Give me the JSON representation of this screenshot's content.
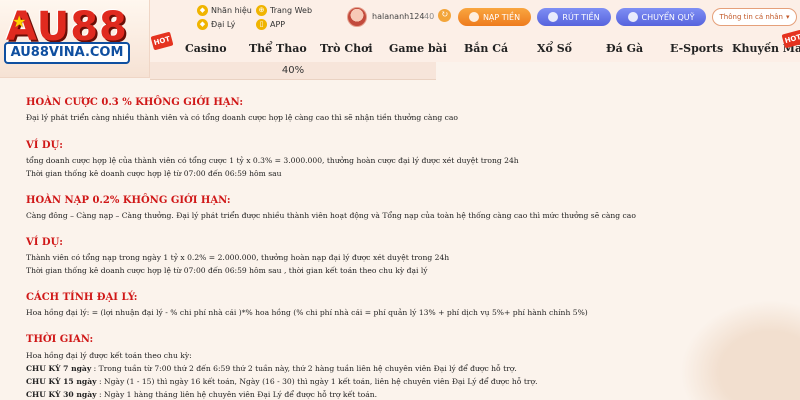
{
  "logo": {
    "main": "AU88",
    "sub": "AU88VINA.COM"
  },
  "header": {
    "links": [
      {
        "label": "Nhãn hiệu",
        "icon": "diamond-icon"
      },
      {
        "label": "Đại Lý",
        "icon": "diamond-icon"
      },
      {
        "label": "Trang Web",
        "icon": "globe-icon"
      },
      {
        "label": "APP",
        "icon": "phone-icon"
      }
    ],
    "username": "halananh124",
    "balance": "40",
    "buttons": {
      "deposit": "NẠP TIỀN",
      "withdraw": "RÚT TIỀN",
      "transfer": "CHUYỂN QUỸ"
    },
    "account_select": "Thông tin cá nhân"
  },
  "nav": [
    {
      "label": "Casino",
      "hot": false
    },
    {
      "label": "Thể Thao",
      "hot": false
    },
    {
      "label": "Trò Chơi",
      "hot": false
    },
    {
      "label": "Game bài",
      "hot": false
    },
    {
      "label": "Bắn Cá",
      "hot": false
    },
    {
      "label": "Xổ Số",
      "hot": false
    },
    {
      "label": "Đá Gà",
      "hot": false
    },
    {
      "label": "E-Sports",
      "hot": false
    },
    {
      "label": "Khuyến Mãi",
      "hot": true
    }
  ],
  "hot_label": "HOT",
  "table_last_row": "40%",
  "content": {
    "s1_title": "HOÀN CƯỢC 0.3 % KHÔNG GIỚI HẠN:",
    "s1_p1": "Đại lý phát triển càng nhiều thành viên và có tổng doanh cược hợp lệ càng cao thì sẽ nhận tiền thưởng càng cao",
    "s1_ex_title": "VÍ DỤ:",
    "s1_ex1": "tổng doanh cược hợp lệ của thành viên có tổng cược 1 tỷ x 0.3% = 3.000.000, thưởng hoàn cược đại lý được xét duyệt trong 24h",
    "s1_ex2": "Thời gian thống kê doanh cược hợp lệ từ 07:00 đến 06:59 hôm sau",
    "s2_title": "HOÀN NẠP 0.2% KHÔNG GIỚI HẠN:",
    "s2_p1": "Càng đông – Càng nạp – Càng thưởng. Đại lý phát triển được nhiều thành viên hoạt động và Tổng nạp của toàn hệ thống càng cao thì mức thưởng sẽ càng cao",
    "s2_ex_title": "VÍ DỤ:",
    "s2_ex1": "Thành viên có tổng nạp trong ngày 1 tỷ x 0.2% = 2.000.000, thưởng hoàn nạp đại lý được xét duyệt trong 24h",
    "s2_ex2": "Thời gian thống kê doanh cược hợp lệ từ 07:00 đến 06:59 hôm sau , thời gian kết toán theo chu kỳ đại lý",
    "s3_title": "CÁCH TÍNH ĐẠI LÝ:",
    "s3_p1": "Hoa hồng đại lý: = (lợi nhuận đại lý - % chi phí nhà cái )*% hoa hồng (% chi phí nhà cái = phí quản lý 13% + phí dịch vụ 5%+ phí hành chính 5%)",
    "s4_title": "THỜI GIAN:",
    "s4_p1": "Hoa hồng đại lý được kết toán theo chu kỳ:",
    "cycles": [
      {
        "label": "CHU KỲ 7 ngày",
        "text": ": Trong tuần từ 7:00 thứ 2 đến 6:59 thứ 2 tuần này, thứ 2 hàng tuần liên hệ chuyên viên Đại lý để được hỗ trợ."
      },
      {
        "label": "CHU KỲ 15 ngày",
        "text": ": Ngày (1 - 15) thì ngày 16 kết toán, Ngày (16 - 30) thì ngày 1 kết toán, liên hệ chuyên viên Đại Lý để được hỗ trợ."
      },
      {
        "label": "CHU KỲ 30 ngày",
        "text": ": Ngày 1 hàng tháng liên hệ chuyên viên Đại Lý để được hỗ trợ kết toán."
      }
    ]
  }
}
